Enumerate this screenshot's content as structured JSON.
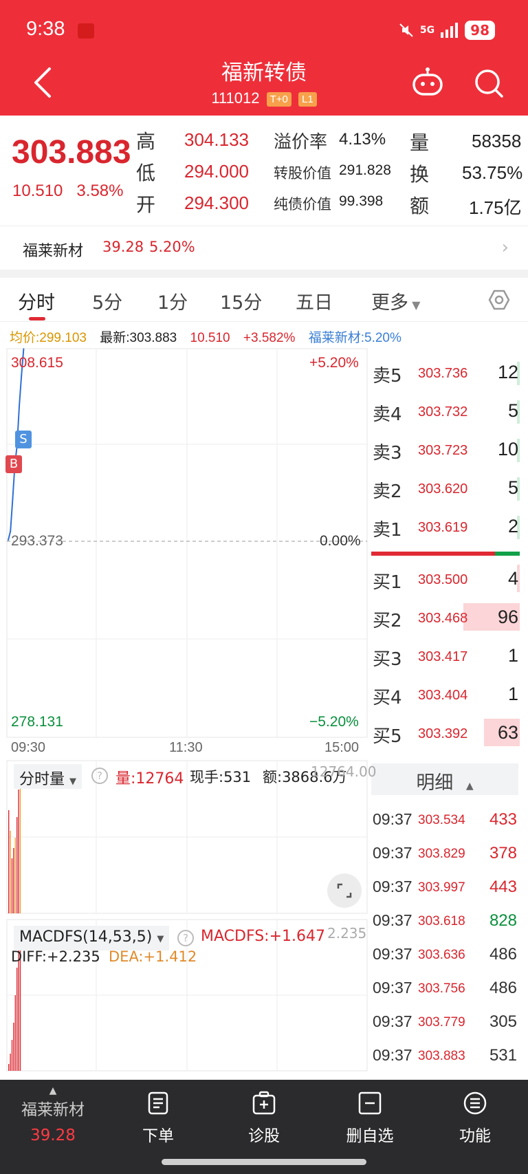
{
  "status_bar": {
    "time": "9:38",
    "network": "5G",
    "battery": "98"
  },
  "header": {
    "title": "福新转债",
    "code": "111012",
    "tag1": "T+0",
    "tag2": "L1"
  },
  "quote": {
    "price": "303.883",
    "change": "10.510",
    "change_pct": "3.58%",
    "high_label": "高",
    "high": "304.133",
    "low_label": "低",
    "low": "294.000",
    "open_label": "开",
    "open": "294.300",
    "premium_label": "溢价率",
    "premium": "4.13%",
    "conv_label": "转股价值",
    "conv_value": "291.828",
    "bond_label": "纯债价值",
    "bond_value": "99.398",
    "vol_label": "量",
    "vol": "58358",
    "turnover_label": "换",
    "turnover": "53.75%",
    "amount_label": "额",
    "amount": "1.75亿"
  },
  "underlying": {
    "name": "福莱新材",
    "price": "39.28",
    "pct": "5.20%"
  },
  "tabs": [
    "分时",
    "5分",
    "1分",
    "15分",
    "五日",
    "更多"
  ],
  "info_line": {
    "avg": "均价:299.103",
    "latest": "最新:303.883",
    "change": "10.510",
    "pct": "+3.582%",
    "stock": "福莱新材:5.20%"
  },
  "chart_labels": {
    "top_price": "308.615",
    "top_pct": "+5.20%",
    "mid_price": "293.373",
    "mid_pct": "0.00%",
    "bot_price": "278.131",
    "bot_pct": "−5.20%",
    "t0": "09:30",
    "t1": "11:30",
    "t2": "15:00",
    "marker_s": "S",
    "marker_b": "B"
  },
  "chart_data": {
    "type": "line",
    "x": [
      "09:30",
      "09:31",
      "09:32",
      "09:33",
      "09:34",
      "09:35",
      "09:36",
      "09:37"
    ],
    "series": [
      {
        "values": [
          293.6,
          294.3,
          296.8,
          299.5,
          301.0,
          304.1,
          306.5,
          308.6
        ]
      }
    ],
    "ylim": [
      278.131,
      308.615
    ],
    "xlabel": "",
    "ylabel": ""
  },
  "order_book": {
    "asks": [
      {
        "label": "卖5",
        "price": "303.736",
        "vol": "12"
      },
      {
        "label": "卖4",
        "price": "303.732",
        "vol": "5"
      },
      {
        "label": "卖3",
        "price": "303.723",
        "vol": "10"
      },
      {
        "label": "卖2",
        "price": "303.620",
        "vol": "5"
      },
      {
        "label": "卖1",
        "price": "303.619",
        "vol": "2"
      }
    ],
    "bids": [
      {
        "label": "买1",
        "price": "303.500",
        "vol": "4"
      },
      {
        "label": "买2",
        "price": "303.468",
        "vol": "96"
      },
      {
        "label": "买3",
        "price": "303.417",
        "vol": "1"
      },
      {
        "label": "买4",
        "price": "303.404",
        "vol": "1"
      },
      {
        "label": "买5",
        "price": "303.392",
        "vol": "63"
      }
    ]
  },
  "detail": {
    "title": "明细",
    "ticks": [
      {
        "time": "09:37",
        "price": "303.534",
        "vol": "433",
        "color": "#d9262e"
      },
      {
        "time": "09:37",
        "price": "303.829",
        "vol": "378",
        "color": "#d9262e"
      },
      {
        "time": "09:37",
        "price": "303.997",
        "vol": "443",
        "color": "#d9262e"
      },
      {
        "time": "09:37",
        "price": "303.618",
        "vol": "828",
        "color": "#0a8f3c"
      },
      {
        "time": "09:37",
        "price": "303.636",
        "vol": "486",
        "color": "#333333"
      },
      {
        "time": "09:37",
        "price": "303.756",
        "vol": "486",
        "color": "#333333"
      },
      {
        "time": "09:37",
        "price": "303.779",
        "vol": "305",
        "color": "#333333"
      },
      {
        "time": "09:37",
        "price": "303.883",
        "vol": "531",
        "color": "#333333"
      }
    ]
  },
  "volume_panel": {
    "dropdown": "分时量",
    "vol": "量:12764",
    "current": "现手:531",
    "amount": "额:3868.6万",
    "max": "12764.00"
  },
  "macd_panel": {
    "dropdown": "MACDFS(14,53,5)",
    "macd": "MACDFS:+1.647",
    "max": "2.235",
    "diff": "DIFF:+2.235",
    "dea": "DEA:+1.412"
  },
  "bottom_bar": {
    "stock_name": "福莱新材",
    "stock_price": "39.28",
    "order": "下单",
    "diagnose": "诊股",
    "remove": "删自选",
    "functions": "功能"
  },
  "colors": {
    "brand_red": "#ee2f3a",
    "up": "#d9262e",
    "down": "#0a8f3c"
  }
}
